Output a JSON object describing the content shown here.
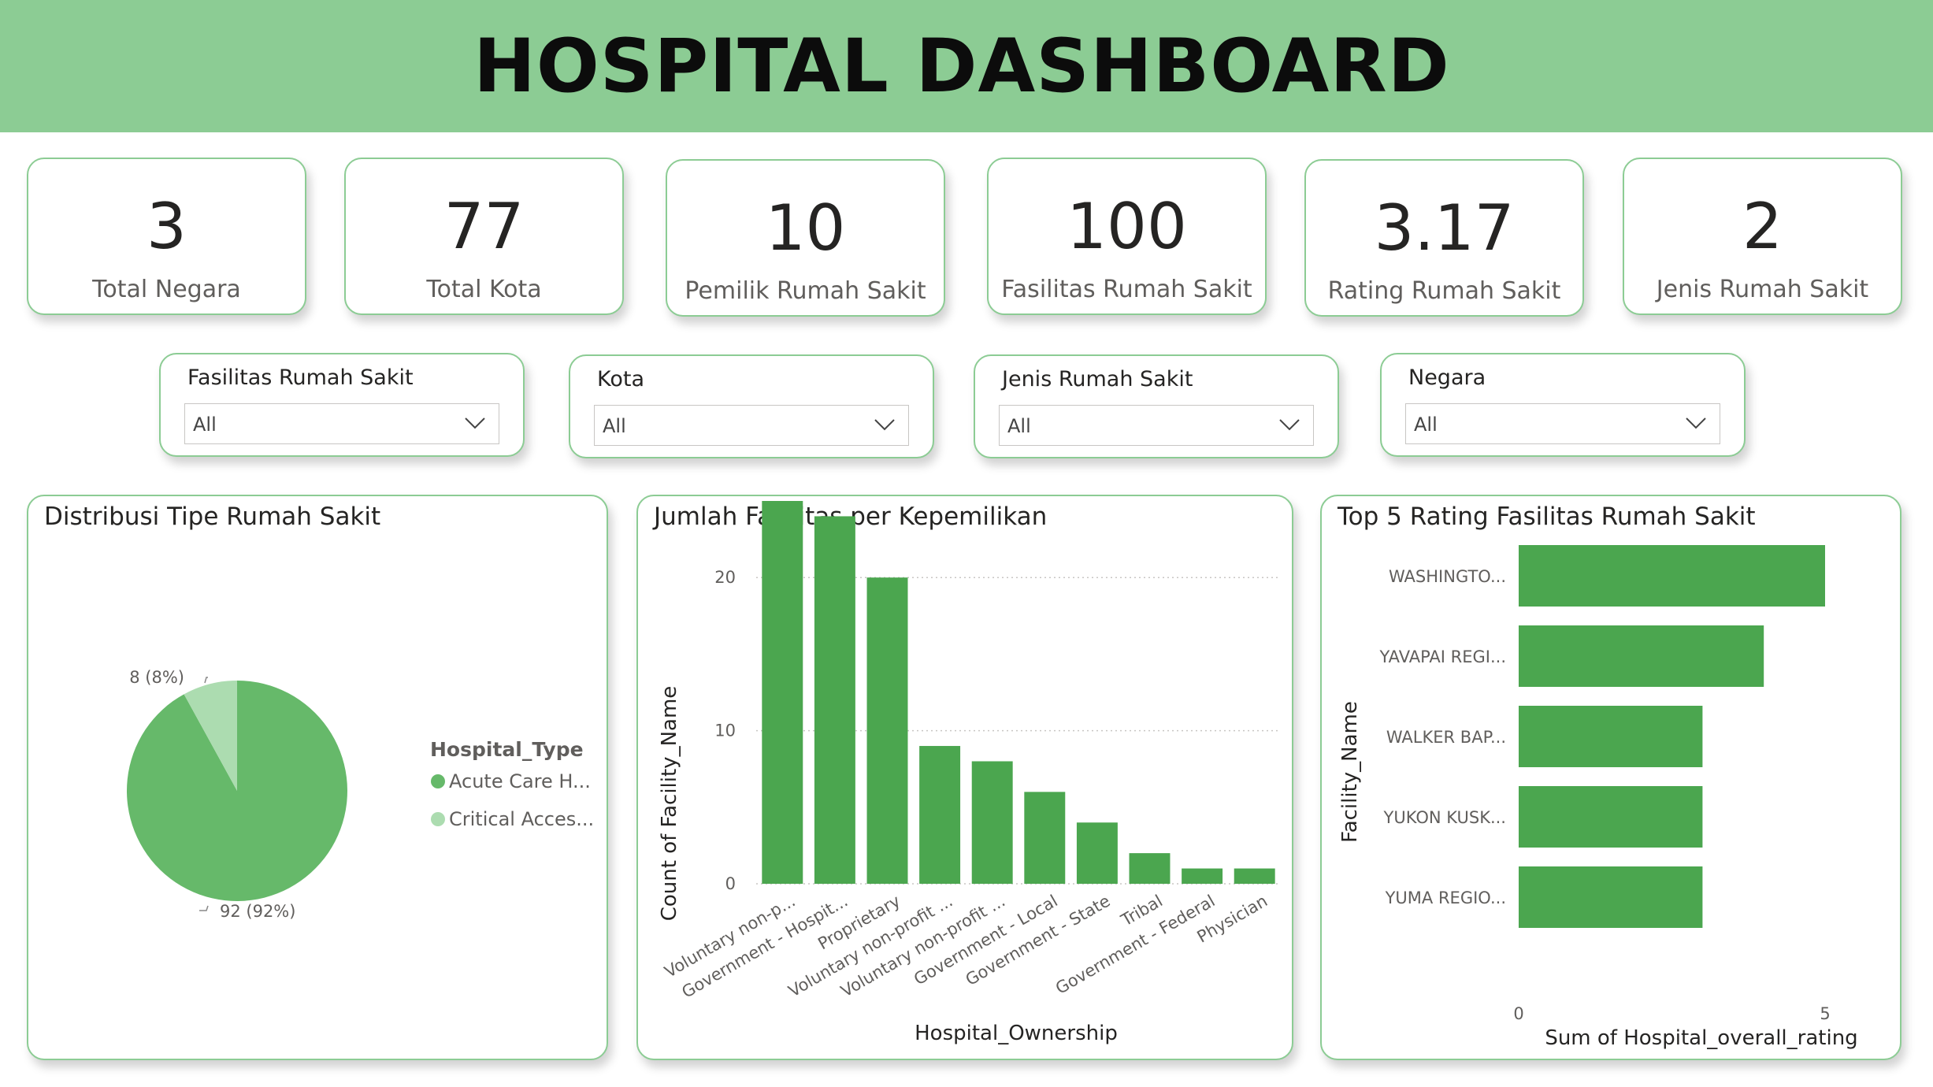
{
  "header": {
    "title": "HOSPITAL DASHBOARD"
  },
  "kpis": [
    {
      "value": "3",
      "label": "Total Negara"
    },
    {
      "value": "77",
      "label": "Total Kota"
    },
    {
      "value": "10",
      "label": "Pemilik Rumah Sakit"
    },
    {
      "value": "100",
      "label": "Fasilitas Rumah Sakit"
    },
    {
      "value": "3.17",
      "label": "Rating Rumah Sakit"
    },
    {
      "value": "2",
      "label": "Jenis Rumah Sakit"
    }
  ],
  "slicers": [
    {
      "title": "Fasilitas Rumah Sakit",
      "value": "All"
    },
    {
      "title": "Kota",
      "value": "All"
    },
    {
      "title": "Jenis Rumah Sakit",
      "value": "All"
    },
    {
      "title": "Negara",
      "value": "All"
    }
  ],
  "colors": {
    "header": "#8ccc94",
    "border": "#8ccc94",
    "bar": "#4ba64f",
    "pie_main": "#66b96a",
    "pie_minor": "#acdcb0"
  },
  "icons": {
    "dropdown": "chevron-down-icon"
  },
  "chart_data": [
    {
      "type": "pie",
      "title": "Distribusi Tipe Rumah Sakit",
      "legend_title": "Hospital_Type",
      "legend_position": "right",
      "slices": [
        {
          "name": "Acute Care H...",
          "value": 92,
          "label": "92 (92%)",
          "color": "#66b96a"
        },
        {
          "name": "Critical Acces...",
          "value": 8,
          "label": "8 (8%)",
          "color": "#acdcb0"
        }
      ]
    },
    {
      "type": "bar",
      "title": "Jumlah Fasilitas per Kepemilikan",
      "xlabel": "Hospital_Ownership",
      "ylabel": "Count of Facility_Name",
      "ylim": [
        0,
        25
      ],
      "yticks": [
        0,
        10,
        20
      ],
      "grid": true,
      "categories": [
        "Voluntary non-p...",
        "Government - Hospit...",
        "Proprietary",
        "Voluntary non-profit ...",
        "Voluntary non-profit ...",
        "Government - Local",
        "Government - State",
        "Tribal",
        "Government - Federal",
        "Physician"
      ],
      "values": [
        25,
        24,
        20,
        9,
        8,
        6,
        4,
        2,
        1,
        1
      ]
    },
    {
      "type": "bar",
      "orientation": "horizontal",
      "title": "Top 5 Rating Fasilitas Rumah Sakit",
      "xlabel": "Sum of Hospital_overall_rating",
      "ylabel": "Facility_Name",
      "xlim": [
        0,
        5
      ],
      "xticks": [
        0,
        5
      ],
      "categories": [
        "WASHINGTO...",
        "YAVAPAI REGI...",
        "WALKER BAP...",
        "YUKON KUSK...",
        "YUMA REGIO..."
      ],
      "values": [
        5,
        4,
        3,
        3,
        3
      ]
    }
  ]
}
